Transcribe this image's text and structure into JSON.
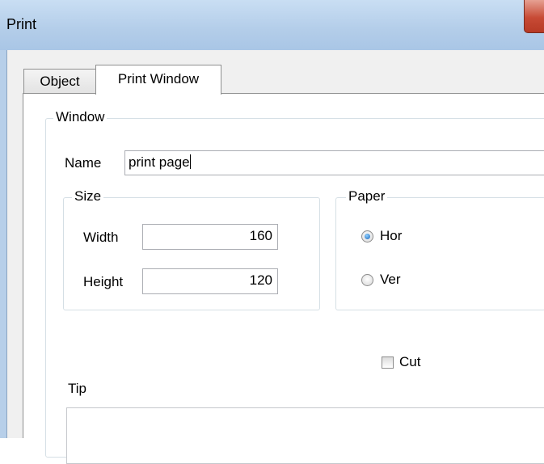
{
  "window": {
    "title": "Print"
  },
  "tabs": [
    {
      "label": "Object"
    },
    {
      "label": "Print Window"
    }
  ],
  "group_window": {
    "legend": "Window",
    "name_label": "Name",
    "name_value": "print page"
  },
  "group_size": {
    "legend": "Size",
    "width_label": "Width",
    "width_value": "160",
    "height_label": "Height",
    "height_value": "120"
  },
  "group_paper": {
    "legend": "Paper",
    "options": [
      {
        "label": "Hor",
        "selected": true
      },
      {
        "label": "Ver",
        "selected": false
      }
    ]
  },
  "cut": {
    "label": "Cut",
    "checked": false
  },
  "tip": {
    "label": "Tip",
    "value": ""
  },
  "colors": {
    "titlebar": "#b3cde9",
    "close_button": "#c74a35",
    "radio_selected": "#1a63b8"
  }
}
